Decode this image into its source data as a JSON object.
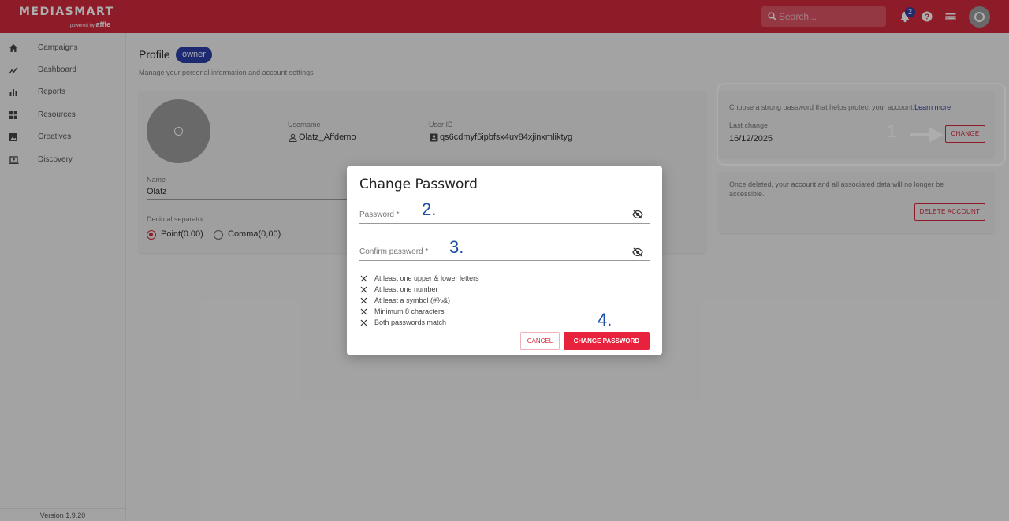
{
  "header": {
    "logo_main": "MEDIASMART",
    "logo_powered": "powered by",
    "logo_brand": "affle",
    "search_placeholder": "Search...",
    "notification_count": "2"
  },
  "sidebar": {
    "items": [
      {
        "label": "Campaigns",
        "icon": "home-icon"
      },
      {
        "label": "Dashboard",
        "icon": "trend-icon"
      },
      {
        "label": "Reports",
        "icon": "bar-chart-icon"
      },
      {
        "label": "Resources",
        "icon": "grid-icon"
      },
      {
        "label": "Creatives",
        "icon": "image-icon"
      },
      {
        "label": "Discovery",
        "icon": "laptop-icon"
      }
    ],
    "version": "Version 1.9.20"
  },
  "profile": {
    "title": "Profile",
    "role": "owner",
    "subtitle": "Manage your personal information and account settings",
    "username_label": "Username",
    "username": "Olatz_Affdemo",
    "userid_label": "User ID",
    "userid": "qs6cdmyf5ipbfsx4uv84xjinxmliktyg",
    "name_label": "Name",
    "name": "Olatz",
    "decimal_label": "Decimal separator",
    "decimal_options": [
      "Point(0.00)",
      "Comma(0,00)"
    ],
    "decimal_selected": "Point(0.00)"
  },
  "password_card": {
    "text": "Choose a strong password that helps protect your account.",
    "link": "Learn more",
    "last_change_label": "Last change",
    "last_change": "16/12/2025",
    "change_button": "CHANGE"
  },
  "delete_card": {
    "text": "Once deleted, your account and all associated data will no longer be accessible.",
    "delete_button": "DELETE ACCOUNT"
  },
  "annotations": {
    "step1": "1.",
    "step2": "2.",
    "step3": "3.",
    "step4": "4."
  },
  "modal": {
    "title": "Change Password",
    "password_label": "Password *",
    "confirm_label": "Confirm password *",
    "requirements": [
      "At least one upper & lower letters",
      "At least one number",
      "At least a symbol (#%&)",
      "Minimum 8 characters",
      "Both passwords match"
    ],
    "cancel": "CANCEL",
    "submit": "CHANGE PASSWORD"
  },
  "colors": {
    "brand": "#d1283c",
    "accent": "#2b3da7",
    "primary_button": "#e8213c"
  }
}
